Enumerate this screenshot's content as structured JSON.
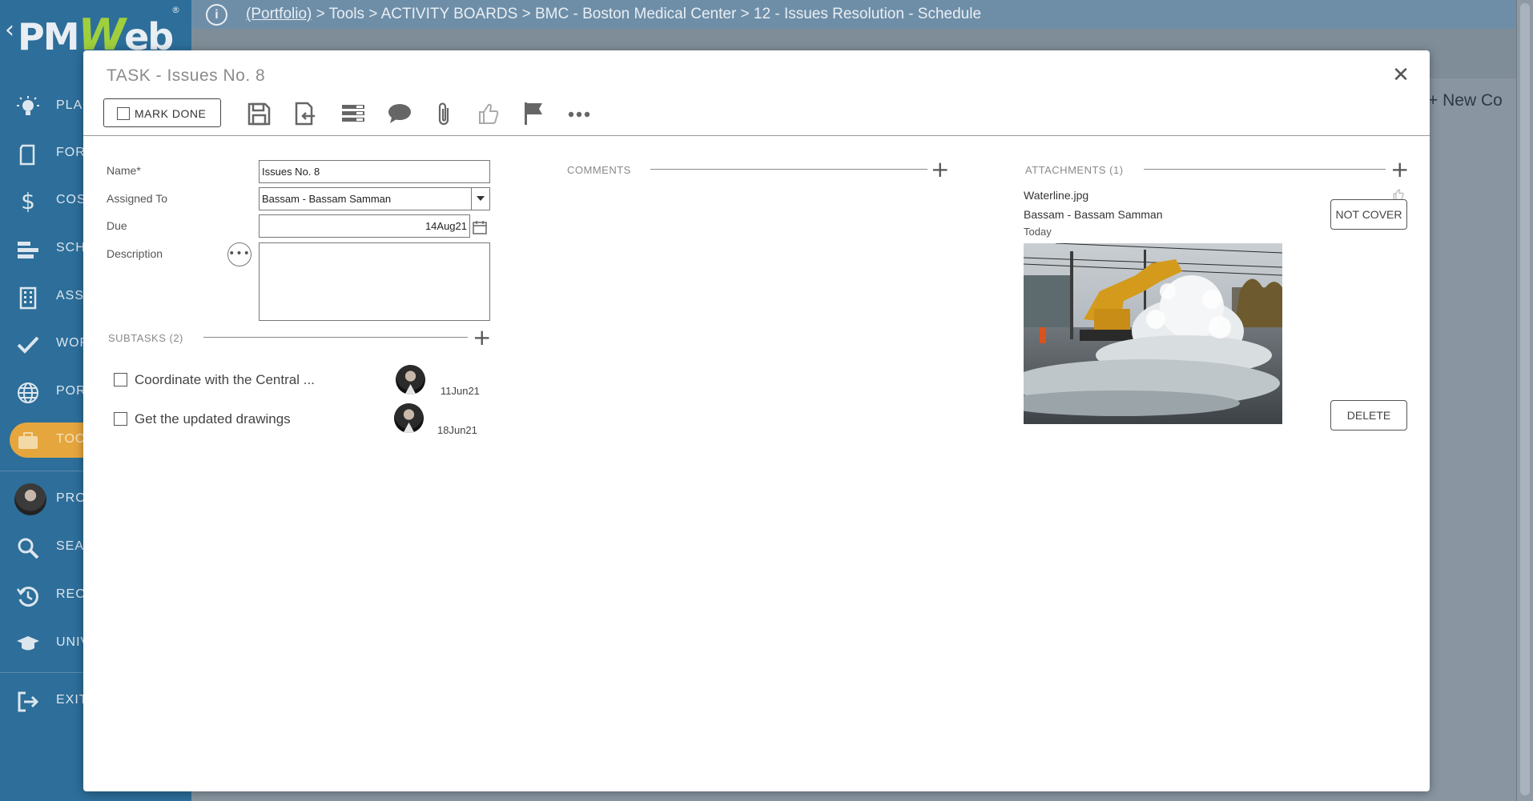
{
  "app": {
    "logo_text_left": "PM",
    "logo_text_w": "W",
    "logo_text_right": "eb",
    "logo_registered": "®"
  },
  "sidebar": {
    "items": [
      {
        "label": "PLAN",
        "icon": "lightbulb-icon"
      },
      {
        "label": "FORM",
        "icon": "form-icon"
      },
      {
        "label": "COST",
        "icon": "dollar-icon"
      },
      {
        "label": "SCHE",
        "icon": "schedule-bars-icon"
      },
      {
        "label": "ASSE",
        "icon": "building-icon"
      },
      {
        "label": "WOR",
        "icon": "checkmark-icon"
      },
      {
        "label": "PORT",
        "icon": "globe-icon"
      },
      {
        "label": "TOO",
        "icon": "briefcase-icon",
        "active": true
      },
      {
        "label": "PRO",
        "icon": "avatar"
      },
      {
        "label": "SEAR",
        "icon": "search-icon"
      },
      {
        "label": "REC",
        "icon": "history-icon"
      },
      {
        "label": "UNIV",
        "icon": "graduation-cap-icon"
      },
      {
        "label": "EXIT",
        "icon": "exit-icon"
      }
    ],
    "active_color": "#e6a63e"
  },
  "topbar": {
    "breadcrumb_link": "(Portfolio)",
    "breadcrumb_rest": " > Tools > ACTIVITY BOARDS > BMC - Boston Medical Center > 12 - Issues Resolution - Schedule"
  },
  "board": {
    "new_column": "+ New Co"
  },
  "modal": {
    "title": "TASK - Issues No. 8",
    "mark_done_label": "MARK DONE",
    "toolbar_icons": [
      "save-icon",
      "export-icon",
      "layout-icon",
      "comment-icon",
      "attach-icon",
      "like-icon",
      "flag-icon",
      "more-icon"
    ],
    "fields": {
      "name_label": "Name*",
      "name_value": "Issues No. 8",
      "assigned_label": "Assigned To",
      "assigned_value": "Bassam - Bassam Samman",
      "due_label": "Due",
      "due_value": "14Aug21",
      "description_label": "Description",
      "description_value": "",
      "description_more": "•••"
    },
    "subtasks": {
      "header": "SUBTASKS (2)",
      "items": [
        {
          "text": "Coordinate with the Central ...",
          "date": "11Jun21",
          "done": false
        },
        {
          "text": "Get the updated drawings",
          "date": "18Jun21",
          "done": false
        }
      ]
    },
    "comments": {
      "header": "COMMENTS"
    },
    "attachments": {
      "header": "ATTACHMENTS (1)",
      "file_name": "Waterline.jpg",
      "uploader": "Bassam - Bassam Samman",
      "uploaded": "Today",
      "not_cover_label": "NOT COVER",
      "delete_label": "DELETE"
    },
    "close_label": "✕",
    "plus_label": "+"
  }
}
